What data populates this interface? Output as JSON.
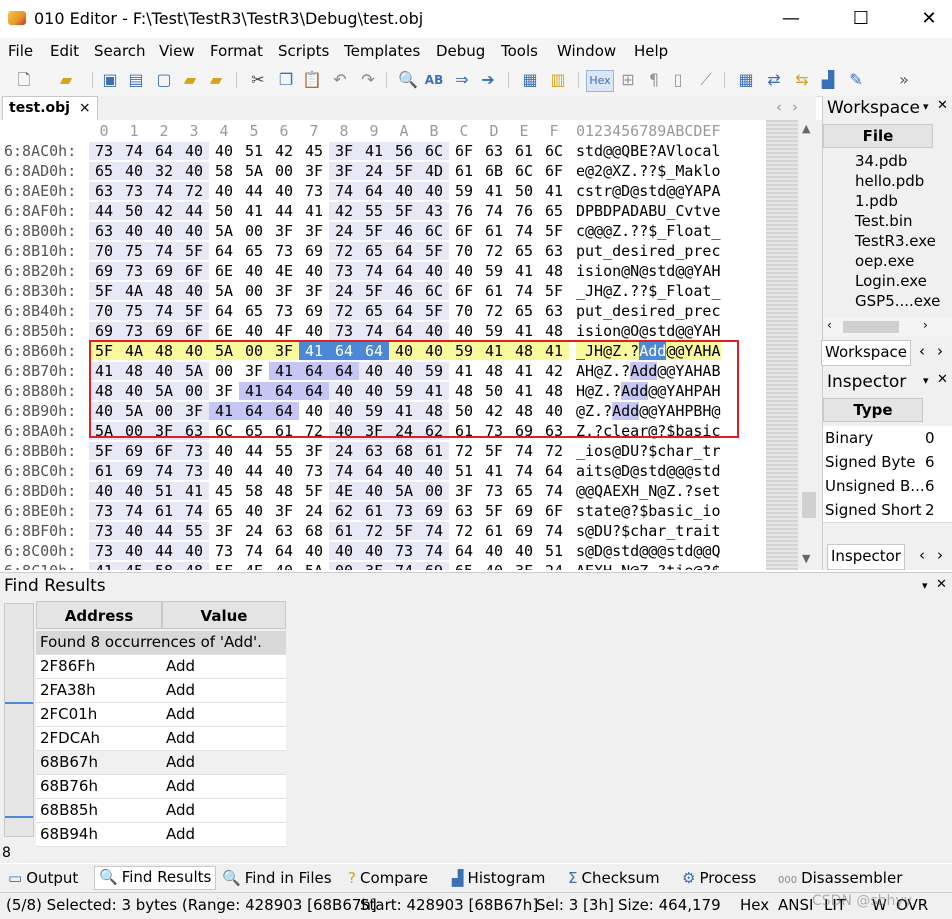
{
  "window": {
    "title": "010 Editor - F:\\Test\\TestR3\\TestR3\\Debug\\test.obj",
    "minimize": "—",
    "maximize": "☐",
    "close": "✕"
  },
  "menu": [
    "File",
    "Edit",
    "Search",
    "View",
    "Format",
    "Scripts",
    "Templates",
    "Debug",
    "Tools",
    "Window",
    "Help"
  ],
  "toolbar": {
    "icons": [
      "new-file-icon",
      "open-folder-icon",
      "save-icon",
      "save-all-icon",
      "open-icon",
      "folder-icon",
      "copy-file-icon",
      "cut-icon",
      "copy-icon",
      "paste-icon",
      "undo-icon",
      "redo-icon",
      "find-icon",
      "replace-icon",
      "goto-icon",
      "template-icon",
      "script-icon",
      "hex-mode-icon",
      "grid-icon",
      "paragraph-icon",
      "highlight-icon",
      "calculator-icon",
      "compare-icon",
      "export-icon",
      "histogram-icon",
      "tools-icon",
      "more-icon"
    ],
    "hex_label": "Hex",
    "more": "»"
  },
  "tab": {
    "label": "test.obj",
    "close": "×"
  },
  "hex": {
    "column_header": [
      "0",
      "1",
      "2",
      "3",
      "4",
      "5",
      "6",
      "7",
      "8",
      "9",
      "A",
      "B",
      "C",
      "D",
      "E",
      "F"
    ],
    "ascii_header": "0123456789ABCDEF",
    "rows": [
      {
        "addr": "6:8AC0h:",
        "bytes": [
          "73",
          "74",
          "64",
          "40",
          "40",
          "51",
          "42",
          "45",
          "3F",
          "41",
          "56",
          "6C",
          "6F",
          "63",
          "61",
          "6C"
        ],
        "ascii": "std@@QBE?AVlocal"
      },
      {
        "addr": "6:8AD0h:",
        "bytes": [
          "65",
          "40",
          "32",
          "40",
          "58",
          "5A",
          "00",
          "3F",
          "3F",
          "24",
          "5F",
          "4D",
          "61",
          "6B",
          "6C",
          "6F"
        ],
        "ascii": "e@2@XZ.??$_Maklo"
      },
      {
        "addr": "6:8AE0h:",
        "bytes": [
          "63",
          "73",
          "74",
          "72",
          "40",
          "44",
          "40",
          "73",
          "74",
          "64",
          "40",
          "40",
          "59",
          "41",
          "50",
          "41"
        ],
        "ascii": "cstr@D@std@@YAPA"
      },
      {
        "addr": "6:8AF0h:",
        "bytes": [
          "44",
          "50",
          "42",
          "44",
          "50",
          "41",
          "44",
          "41",
          "42",
          "55",
          "5F",
          "43",
          "76",
          "74",
          "76",
          "65"
        ],
        "ascii": "DPBDPADABU_Cvtve"
      },
      {
        "addr": "6:8B00h:",
        "bytes": [
          "63",
          "40",
          "40",
          "40",
          "5A",
          "00",
          "3F",
          "3F",
          "24",
          "5F",
          "46",
          "6C",
          "6F",
          "61",
          "74",
          "5F"
        ],
        "ascii": "c@@@Z.??$_Float_"
      },
      {
        "addr": "6:8B10h:",
        "bytes": [
          "70",
          "75",
          "74",
          "5F",
          "64",
          "65",
          "73",
          "69",
          "72",
          "65",
          "64",
          "5F",
          "70",
          "72",
          "65",
          "63"
        ],
        "ascii": "put_desired_prec"
      },
      {
        "addr": "6:8B20h:",
        "bytes": [
          "69",
          "73",
          "69",
          "6F",
          "6E",
          "40",
          "4E",
          "40",
          "73",
          "74",
          "64",
          "40",
          "40",
          "59",
          "41",
          "48"
        ],
        "ascii": "ision@N@std@@YAH"
      },
      {
        "addr": "6:8B30h:",
        "bytes": [
          "5F",
          "4A",
          "48",
          "40",
          "5A",
          "00",
          "3F",
          "3F",
          "24",
          "5F",
          "46",
          "6C",
          "6F",
          "61",
          "74",
          "5F"
        ],
        "ascii": "_JH@Z.??$_Float_"
      },
      {
        "addr": "6:8B40h:",
        "bytes": [
          "70",
          "75",
          "74",
          "5F",
          "64",
          "65",
          "73",
          "69",
          "72",
          "65",
          "64",
          "5F",
          "70",
          "72",
          "65",
          "63"
        ],
        "ascii": "put_desired_prec"
      },
      {
        "addr": "6:8B50h:",
        "bytes": [
          "69",
          "73",
          "69",
          "6F",
          "6E",
          "40",
          "4F",
          "40",
          "73",
          "74",
          "64",
          "40",
          "40",
          "59",
          "41",
          "48"
        ],
        "ascii": "ision@O@std@@YAH"
      },
      {
        "addr": "6:8B60h:",
        "bytes": [
          "5F",
          "4A",
          "48",
          "40",
          "5A",
          "00",
          "3F",
          "41",
          "64",
          "64",
          "40",
          "40",
          "59",
          "41",
          "48",
          "41"
        ],
        "ascii": "_JH@Z.?Add@@YAHA"
      },
      {
        "addr": "6:8B70h:",
        "bytes": [
          "41",
          "48",
          "40",
          "5A",
          "00",
          "3F",
          "41",
          "64",
          "64",
          "40",
          "40",
          "59",
          "41",
          "48",
          "41",
          "42"
        ],
        "ascii": "AH@Z.?Add@@YAHAB"
      },
      {
        "addr": "6:8B80h:",
        "bytes": [
          "48",
          "40",
          "5A",
          "00",
          "3F",
          "41",
          "64",
          "64",
          "40",
          "40",
          "59",
          "41",
          "48",
          "50",
          "41",
          "48"
        ],
        "ascii": "H@Z.?Add@@YAHPAH"
      },
      {
        "addr": "6:8B90h:",
        "bytes": [
          "40",
          "5A",
          "00",
          "3F",
          "41",
          "64",
          "64",
          "40",
          "40",
          "59",
          "41",
          "48",
          "50",
          "42",
          "48",
          "40"
        ],
        "ascii": "@Z.?Add@@YAHPBH@"
      },
      {
        "addr": "6:8BA0h:",
        "bytes": [
          "5A",
          "00",
          "3F",
          "63",
          "6C",
          "65",
          "61",
          "72",
          "40",
          "3F",
          "24",
          "62",
          "61",
          "73",
          "69",
          "63"
        ],
        "ascii": "Z.?clear@?$basic"
      },
      {
        "addr": "6:8BB0h:",
        "bytes": [
          "5F",
          "69",
          "6F",
          "73",
          "40",
          "44",
          "55",
          "3F",
          "24",
          "63",
          "68",
          "61",
          "72",
          "5F",
          "74",
          "72"
        ],
        "ascii": "_ios@DU?$char_tr"
      },
      {
        "addr": "6:8BC0h:",
        "bytes": [
          "61",
          "69",
          "74",
          "73",
          "40",
          "44",
          "40",
          "73",
          "74",
          "64",
          "40",
          "40",
          "51",
          "41",
          "74",
          "64"
        ],
        "ascii": "aits@D@std@@@std"
      },
      {
        "addr": "6:8BD0h:",
        "bytes": [
          "40",
          "40",
          "51",
          "41",
          "45",
          "58",
          "48",
          "5F",
          "4E",
          "40",
          "5A",
          "00",
          "3F",
          "73",
          "65",
          "74"
        ],
        "ascii": "@@QAEXH_N@Z.?set"
      },
      {
        "addr": "6:8BE0h:",
        "bytes": [
          "73",
          "74",
          "61",
          "74",
          "65",
          "40",
          "3F",
          "24",
          "62",
          "61",
          "73",
          "69",
          "63",
          "5F",
          "69",
          "6F"
        ],
        "ascii": "state@?$basic_io"
      },
      {
        "addr": "6:8BF0h:",
        "bytes": [
          "73",
          "40",
          "44",
          "55",
          "3F",
          "24",
          "63",
          "68",
          "61",
          "72",
          "5F",
          "74",
          "72",
          "61",
          "69",
          "74"
        ],
        "ascii": "s@DU?$char_trait"
      },
      {
        "addr": "6:8C00h:",
        "bytes": [
          "73",
          "40",
          "44",
          "40",
          "73",
          "74",
          "64",
          "40",
          "40",
          "40",
          "73",
          "74",
          "64",
          "40",
          "40",
          "51"
        ],
        "ascii": "s@D@std@@@std@@Q"
      },
      {
        "addr": "6:8C10h:",
        "bytes": [
          "41",
          "45",
          "58",
          "48",
          "5F",
          "4E",
          "40",
          "5A",
          "00",
          "3F",
          "74",
          "69",
          "65",
          "40",
          "3F",
          "24"
        ],
        "ascii": "AEXH_N@Z.?tie@?$"
      }
    ]
  },
  "workspace": {
    "title": "Workspace",
    "column": "File",
    "files": [
      "34.pdb",
      "hello.pdb",
      "1.pdb",
      "Test.bin",
      "TestR3.exe",
      "oep.exe",
      "Login.exe",
      "GSP5....exe"
    ],
    "tab": "Workspace"
  },
  "inspector": {
    "title": "Inspector",
    "column": "Type",
    "types": [
      "Binary",
      "Signed Byte",
      "Unsigned B...",
      "Signed Short"
    ],
    "values": [
      "0",
      "6",
      "6",
      "2"
    ],
    "tab": "Inspector"
  },
  "find": {
    "title": "Find Results",
    "col_address": "Address",
    "col_value": "Value",
    "summary": "Found 8 occurrences of 'Add'.",
    "results": [
      {
        "address": "2F86Fh",
        "value": "Add"
      },
      {
        "address": "2FA38h",
        "value": "Add"
      },
      {
        "address": "2FC01h",
        "value": "Add"
      },
      {
        "address": "2FDCAh",
        "value": "Add"
      },
      {
        "address": "68B67h",
        "value": "Add"
      },
      {
        "address": "68B76h",
        "value": "Add"
      },
      {
        "address": "68B85h",
        "value": "Add"
      },
      {
        "address": "68B94h",
        "value": "Add"
      }
    ],
    "count": "8"
  },
  "bottom_tabs": [
    "Output",
    "Find Results",
    "Find in Files",
    "Compare",
    "Histogram",
    "Checksum",
    "Process",
    "Disassembler"
  ],
  "status": {
    "selection": "(5/8) Selected: 3 bytes (Range: 428903 [68B67h]",
    "start": "Start: 428903 [68B67h]",
    "sel": "Sel: 3 [3h]",
    "size": "Size: 464,179",
    "mode": "Hex",
    "charset": "ANSI",
    "lit": "LIT",
    "w": "W",
    "ovr": "OVR",
    "watermark": "CSDN @sbhyy"
  }
}
